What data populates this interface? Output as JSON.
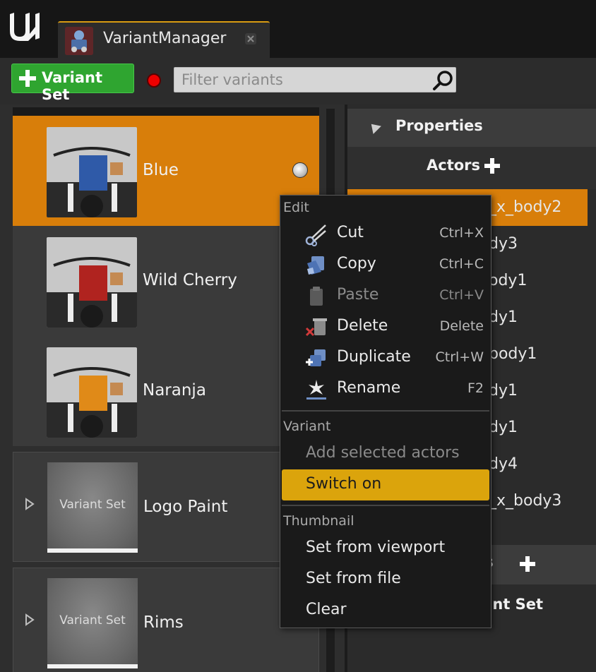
{
  "app": {
    "tab_title": "VariantManager",
    "logo": "unreal-engine-logo"
  },
  "toolbar": {
    "add_label": "Variant Set",
    "filter_placeholder": "Filter variants"
  },
  "variants": [
    {
      "label": "Blue",
      "selected": true,
      "accent": "#2f5aa8"
    },
    {
      "label": "Wild Cherry",
      "selected": false,
      "accent": "#b0231f"
    },
    {
      "label": "Naranja",
      "selected": false,
      "accent": "#e08a18"
    }
  ],
  "variant_sets": [
    {
      "label": "Logo Paint",
      "thumb_label": "Variant Set"
    },
    {
      "label": "Rims",
      "thumb_label": "Variant Set"
    }
  ],
  "properties": {
    "title": "Properties",
    "actors_title": "Actors",
    "actors": [
      "_x_body2",
      "dy3",
      "ody1",
      "dy1",
      "body1",
      "dy1",
      "dy1",
      "dy4",
      "_x_body3"
    ],
    "active_actor_index": 0,
    "second_title": "es",
    "variant_set_label": "iant Set"
  },
  "context_menu": {
    "edit_section": "Edit",
    "items": [
      {
        "label": "Cut",
        "shortcut": "Ctrl+X",
        "icon": "scissors-icon"
      },
      {
        "label": "Copy",
        "shortcut": "Ctrl+C",
        "icon": "copy-icon"
      },
      {
        "label": "Paste",
        "shortcut": "Ctrl+V",
        "icon": "paste-icon",
        "disabled": true
      },
      {
        "label": "Delete",
        "shortcut": "Delete",
        "icon": "delete-icon"
      },
      {
        "label": "Duplicate",
        "shortcut": "Ctrl+W",
        "icon": "duplicate-icon"
      },
      {
        "label": "Rename",
        "shortcut": "F2",
        "icon": "rename-icon"
      }
    ],
    "variant_section": "Variant",
    "add_selected": "Add selected actors",
    "switch_on": "Switch on",
    "thumbnail_section": "Thumbnail",
    "set_from_viewport": "Set from viewport",
    "set_from_file": "Set from file",
    "clear": "Clear"
  },
  "colors": {
    "selection": "#d87e0a",
    "menu_highlight": "#dba40c",
    "add_button": "#2fa530",
    "record": "#e00000"
  }
}
